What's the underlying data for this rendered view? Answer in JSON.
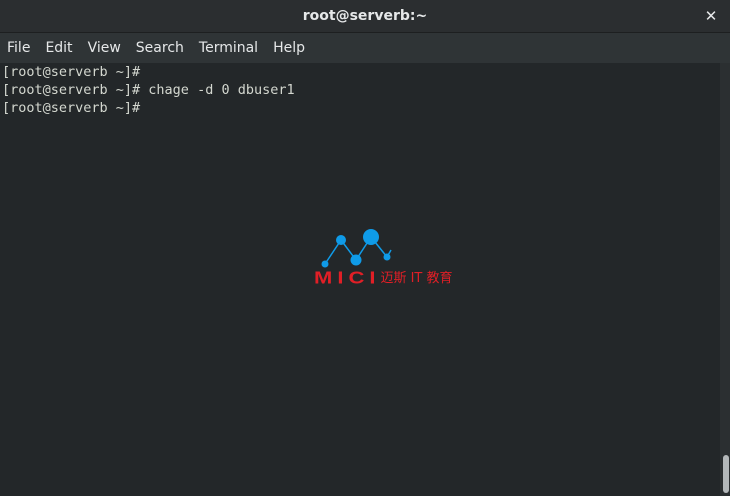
{
  "window": {
    "title": "root@serverb:~",
    "close_glyph": "✕"
  },
  "menu": {
    "items": [
      {
        "label": "File"
      },
      {
        "label": "Edit"
      },
      {
        "label": "View"
      },
      {
        "label": "Search"
      },
      {
        "label": "Terminal"
      },
      {
        "label": "Help"
      }
    ]
  },
  "terminal": {
    "lines": [
      "[root@serverb ~]#",
      "[root@serverb ~]# chage -d 0 dbuser1",
      "[root@serverb ~]#"
    ]
  },
  "watermark": {
    "brand": "MICI",
    "subtitle": "迈斯 IT 教育",
    "logo_color": "#0f9be8",
    "text_color": "#e01f26"
  },
  "colors": {
    "terminal_bg": "#232729",
    "text": "#d3d7cf",
    "titlebar_bg": "#2b2e30"
  }
}
